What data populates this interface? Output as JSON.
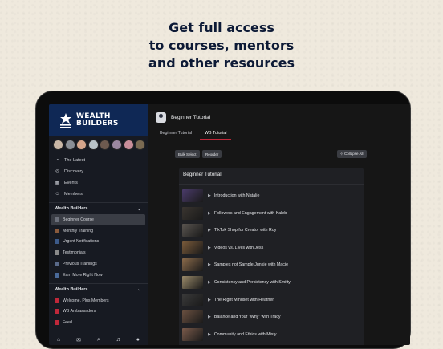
{
  "headline": [
    "Get full access",
    "to courses, mentors",
    "and other resources"
  ],
  "brand": {
    "line1": "WEALTH",
    "line2": "BUILDERS"
  },
  "avatar_colors": [
    "#c9b7a6",
    "#8a8f96",
    "#d6a68b",
    "#b9c3c8",
    "#6d5a4f",
    "#9b87a0",
    "#c98e9a",
    "#7a6a52"
  ],
  "nav": [
    {
      "icon": "◔",
      "icon_name": "latest-icon",
      "label": "The Latest"
    },
    {
      "icon": "◎",
      "icon_name": "compass-icon",
      "label": "Discovery"
    },
    {
      "icon": "▦",
      "icon_name": "calendar-icon",
      "label": "Events"
    },
    {
      "icon": "☺",
      "icon_name": "members-icon",
      "label": "Members"
    }
  ],
  "section1": {
    "title": "Wealth Builders",
    "chevron": "⌄"
  },
  "section1_items": [
    {
      "label": "Beginner Course",
      "color": "#6b6f7a",
      "active": true
    },
    {
      "label": "Monthly Training",
      "color": "#8a5a3c"
    },
    {
      "label": "Urgent Notifications",
      "color": "#3c5a8a"
    },
    {
      "label": "Testimonials",
      "color": "#8a8a8a"
    },
    {
      "label": "Previous Trainings",
      "color": "#5a6a8a"
    },
    {
      "label": "Earn More Right Now",
      "color": "#4a6a9a"
    }
  ],
  "section2": {
    "title": "Wealth Builders",
    "chevron": "⌄"
  },
  "section2_items": [
    {
      "label": "Welcome, Plus Members",
      "color": "#c0283a"
    },
    {
      "label": "WB Ambassadors",
      "color": "#c0283a"
    },
    {
      "label": "Feed",
      "color": "#c0283a"
    }
  ],
  "bottom_icons": [
    {
      "glyph": "⌂",
      "name": "home-icon"
    },
    {
      "glyph": "✉",
      "name": "messages-icon"
    },
    {
      "glyph": "⌕",
      "name": "search-icon"
    },
    {
      "glyph": "♫",
      "name": "notifications-icon"
    },
    {
      "glyph": "●",
      "name": "profile-icon"
    }
  ],
  "course": {
    "title": "Beginner Tutorial"
  },
  "tabs": [
    {
      "label": "Beginner Tutorial",
      "active": false
    },
    {
      "label": "WB Tutorial",
      "active": true
    }
  ],
  "buttons": {
    "bulk_select": "Bulk Select",
    "reorder": "Reorder",
    "collapse_all": "⊹ Collapse All"
  },
  "panel_title": "Beginner Tutorial",
  "lessons": [
    {
      "title": "Introduction with Natalie",
      "thumb": "#4a3b6a"
    },
    {
      "title": "Followers and Engagement with Kaleb",
      "thumb": "#3a3530"
    },
    {
      "title": "TikTok Shop for Creator with Roy",
      "thumb": "#5a5550"
    },
    {
      "title": "Videos vs. Lives with Jess",
      "thumb": "#7a5a3a"
    },
    {
      "title": "Samples not Sample Junkie with Macie",
      "thumb": "#8a6a4a"
    },
    {
      "title": "Consistency and Persistency with Smitty",
      "thumb": "#9a8a6a"
    },
    {
      "title": "The Right Mindset with Heather",
      "thumb": "#3a3a3a"
    },
    {
      "title": "Balance and Your \"Why\" with Tracy",
      "thumb": "#6a5040"
    },
    {
      "title": "Community and Ethics with Misty",
      "thumb": "#7a5a4a"
    }
  ]
}
